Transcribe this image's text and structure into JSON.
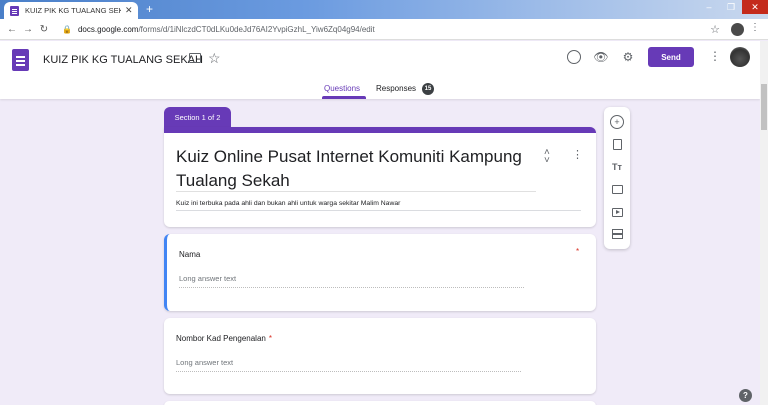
{
  "browser": {
    "tab_title": "KUIZ PIK KG TUALANG SEKAH -",
    "tab_close": "✕",
    "new_tab": "+",
    "url_host": "docs.google.com",
    "url_path": "/forms/d/1iNlczdCT0dLKu0deJd76AI2YvpiGzhL_Yiw6Zq04g94/edit"
  },
  "header": {
    "title": "KUIZ PIK KG TUALANG SEKAH",
    "send_label": "Send",
    "icons": [
      "forms-logo",
      "folder-icon",
      "star-icon",
      "palette-icon",
      "eye-icon",
      "gear-icon",
      "more-icon",
      "avatar"
    ]
  },
  "tabs": {
    "questions": "Questions",
    "responses": "Responses",
    "responses_count": "15"
  },
  "section": {
    "label": "Section 1 of 2"
  },
  "form": {
    "title": "Kuiz Online Pusat Internet Komuniti Kampung Tualang Sekah",
    "description": "Kuiz ini terbuka pada ahli dan bukan ahli untuk warga sekitar Malim Nawar"
  },
  "questions": [
    {
      "label": "Nama",
      "answer_placeholder": "Long answer text",
      "required": "*"
    },
    {
      "label": "Nombor Kad Pengenalan",
      "answer_placeholder": "Long answer text",
      "required": "*"
    }
  ],
  "toolbar": [
    "add-question-icon",
    "import-questions-icon",
    "add-title-icon",
    "add-image-icon",
    "add-video-icon",
    "add-section-icon"
  ],
  "colors": {
    "accent": "#673ab7",
    "background": "#f0ebf8",
    "active_border": "#4285f4",
    "required": "#d93025"
  }
}
